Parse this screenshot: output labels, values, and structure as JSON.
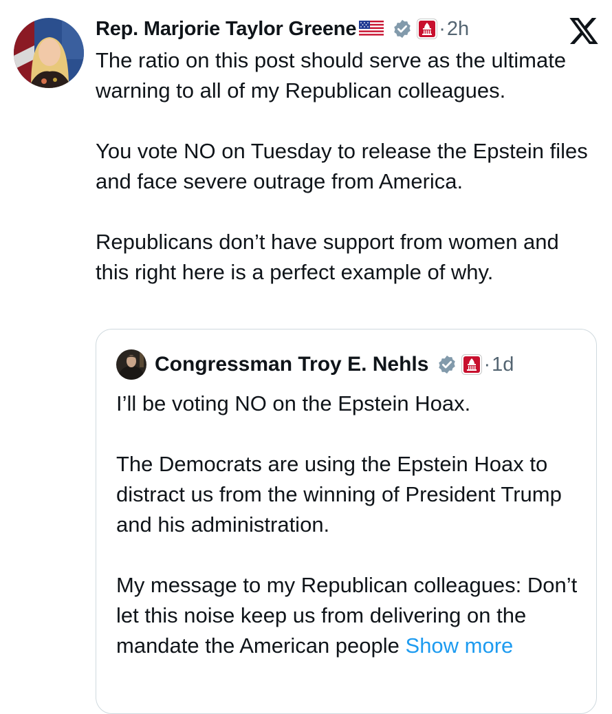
{
  "post": {
    "author_name": "Rep. Marjorie Taylor Greene",
    "separator": "·",
    "time": "2h",
    "paragraphs": [
      "The ratio on this post should serve as the ultimate warning to all of my Republican colleagues.",
      "You vote NO on Tuesday to release the Epstein files and face severe outrage from America.",
      "Republicans don’t have support from women and this right here is a perfect example of why."
    ]
  },
  "quoted_post": {
    "author_name": "Congressman Troy E. Nehls",
    "separator": "·",
    "time": "1d",
    "paragraphs": [
      "I’ll be voting NO on the Epstein Hoax.",
      "The Democrats are using the Epstein Hoax to distract us from the winning of President Trump and his administration.",
      "My message to my Republican colleagues: Don’t let this noise keep us from delivering on the mandate the American people"
    ],
    "show_more_label": "Show more"
  },
  "icons": {
    "brand": "x-logo-icon",
    "verified": "verified-badge-icon",
    "affiliation": "us-capitol-gop-badge-icon",
    "flag": "us-flag-icon"
  },
  "colors": {
    "text": "#0f1419",
    "muted": "#536471",
    "link": "#1d9bf0",
    "verified": "#829aab",
    "badge_red": "#c8102e",
    "border": "#cfd9de"
  }
}
